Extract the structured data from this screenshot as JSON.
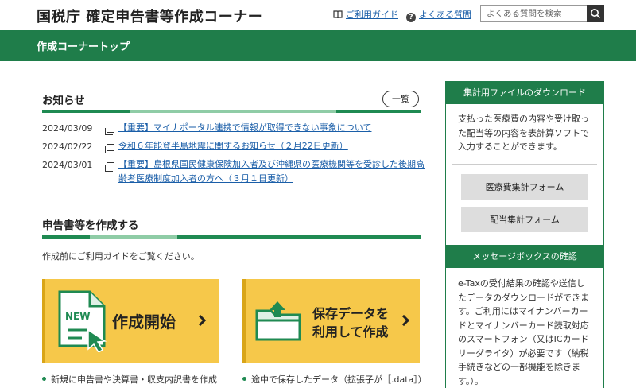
{
  "header": {
    "title": "国税庁 確定申告書等作成コーナー",
    "guide_link": "ご利用ガイド",
    "faq_link": "よくある質問",
    "search_placeholder": "よくある質問を検索"
  },
  "banner": {
    "title": "作成コーナートップ"
  },
  "news": {
    "heading": "お知らせ",
    "all_button": "一覧",
    "items": [
      {
        "date": "2024/03/09",
        "text": "【重要】マイナポータル連携で情報が取得できない事象について"
      },
      {
        "date": "2024/02/22",
        "text": "令和６年能登半島地震に関するお知らせ（２月22日更新）"
      },
      {
        "date": "2024/03/01",
        "text_line1": "【重要】島根県国民健康保険加入者及び沖縄県の医療機関等を受診した後期高",
        "text_line2": "齢者医療制度加入者の方へ（３月１日更新）"
      }
    ]
  },
  "create": {
    "heading": "申告書等を作成する",
    "intro": "作成前にご利用ガイドをご覧ください。",
    "new_card": {
      "badge": "NEW",
      "label": "作成開始",
      "note": "新規に申告書や決算書・収支内訳書を作成"
    },
    "saved_card": {
      "label_line1": "保存データを",
      "label_line2": "利用して作成",
      "note": "途中で保存したデータ（拡張子が［.data］）"
    }
  },
  "sidebar": {
    "download": {
      "heading": "集計用ファイルのダウンロード",
      "text": "支払った医療費の内容や受け取った配当等の内容を表計算ソフトで入力することができます。",
      "buttons": [
        "医療費集計フォーム",
        "配当集計フォーム"
      ]
    },
    "messagebox": {
      "heading": "メッセージボックスの確認",
      "text": "e-Taxの受付結果の確認や送信したデータのダウンロードができます。ご利用にはマイナンバーカードとマイナンバーカード読取対応のスマートフォン（又はICカードリーダライタ）が必要です（納税手続きなどの一部機能を除きます。）。"
    }
  },
  "colors": {
    "brand_green": "#1f7d4a",
    "card_yellow": "#f6c84a",
    "link_blue": "#1a5ea8"
  },
  "icons": [
    "book-icon",
    "question-icon",
    "search-icon",
    "document-icon",
    "new-document-icon",
    "folder-upload-icon",
    "chevron-right-icon"
  ]
}
